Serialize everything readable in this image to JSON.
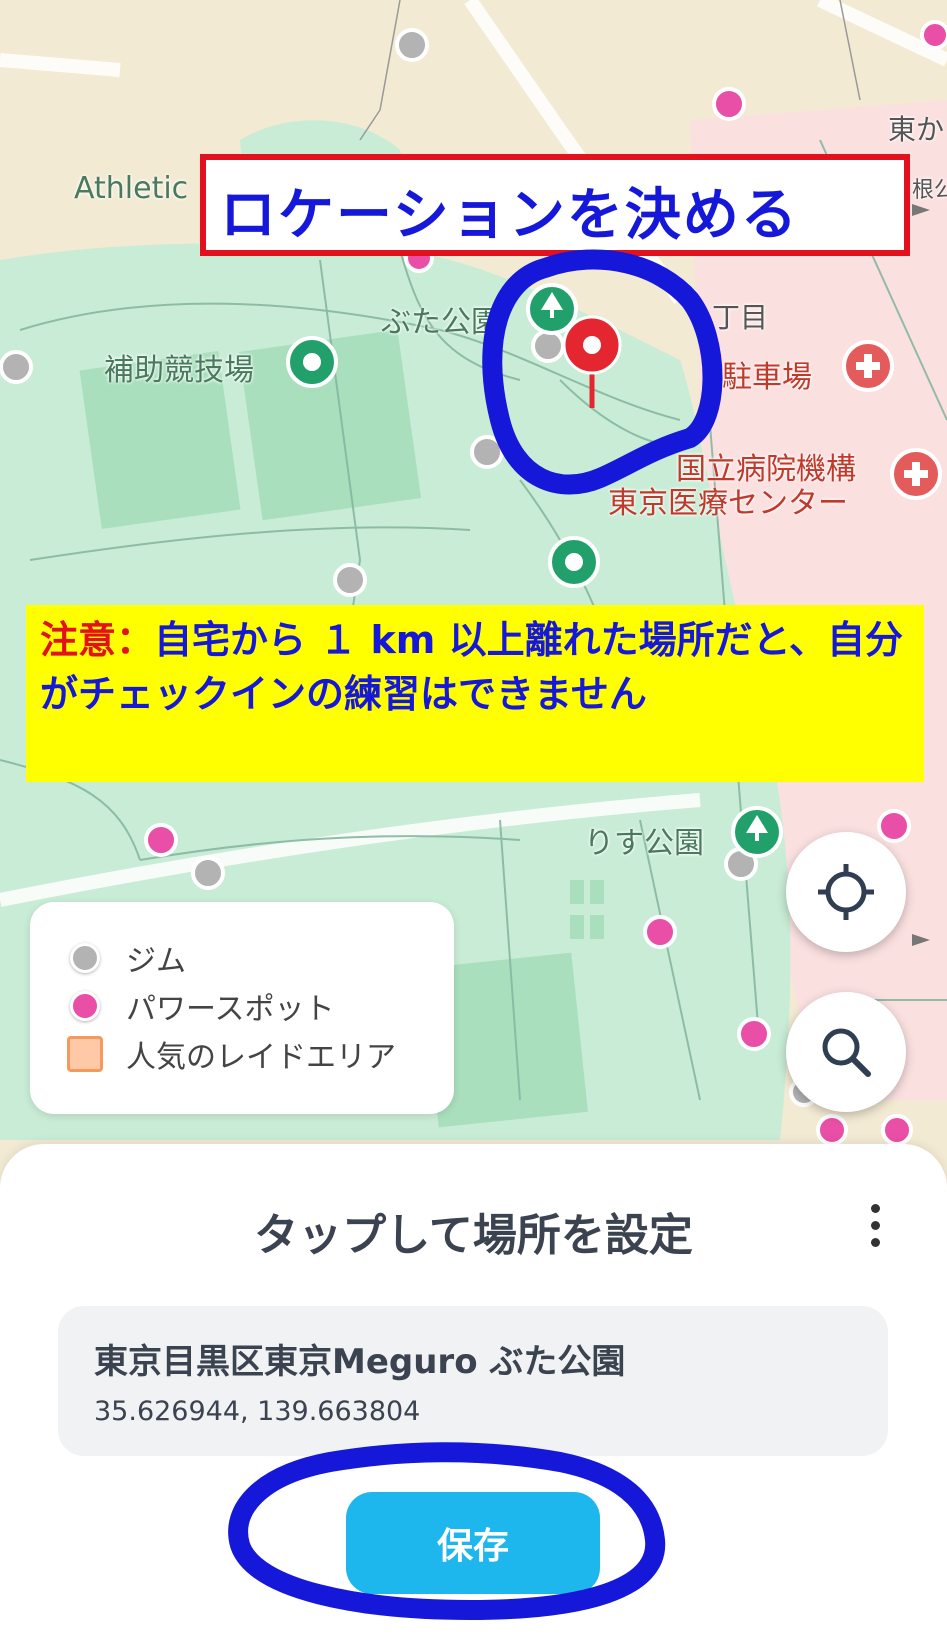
{
  "map": {
    "labels": {
      "athletic": "Athletic",
      "park_buta": "ぶた公園",
      "aux_field": "補助競技場",
      "chome": "丁目",
      "parking": "駐車場",
      "hospital_line1": "国立病院機構",
      "hospital_line2": "東京医療センター",
      "park_risu": "りす公園",
      "edge_top": "東か",
      "edge_side": "根公"
    },
    "pin_color": "#e3262f",
    "park_color": "#c9ecd6",
    "gym_color": "#b3b3b3",
    "power_spot_color": "#e94fa6"
  },
  "annotation": {
    "title": "ロケーションを決める",
    "note_lead": "注意：",
    "note_body": "自宅から １ km 以上離れた場所だと、自分がチェックインの練習はできません"
  },
  "controls": {
    "locate_icon": "crosshair-icon",
    "search_icon": "search-icon"
  },
  "legend": {
    "items": [
      {
        "label": "ジム",
        "color": "#b3b3b3"
      },
      {
        "label": "パワースポット",
        "color": "#e94fa6"
      },
      {
        "label": "人気のレイドエリア",
        "color": "#ffc9a8"
      }
    ]
  },
  "sheet": {
    "title": "タップして場所を設定",
    "address_name": "東京目黒区東京Meguro ぶた公園",
    "coordinates": "35.626944, 139.663804",
    "save_label": "保存"
  }
}
